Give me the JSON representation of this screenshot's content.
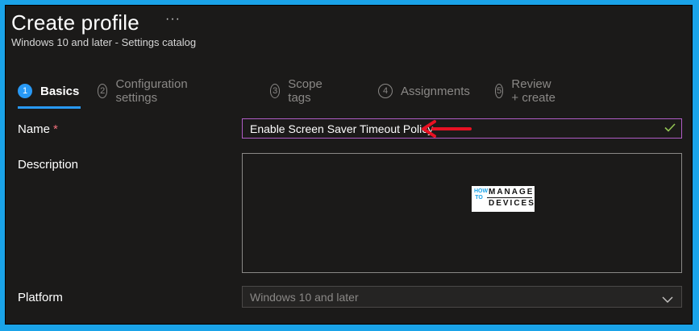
{
  "header": {
    "title": "Create profile",
    "more_label": "···",
    "subtitle": "Windows 10 and later - Settings catalog"
  },
  "steps": [
    {
      "num": "1",
      "label": "Basics",
      "active": true
    },
    {
      "num": "2",
      "label": "Configuration settings",
      "active": false
    },
    {
      "num": "3",
      "label": "Scope tags",
      "active": false
    },
    {
      "num": "4",
      "label": "Assignments",
      "active": false
    },
    {
      "num": "5",
      "label": "Review + create",
      "active": false
    }
  ],
  "form": {
    "name_label": "Name",
    "required_mark": "*",
    "name_value": "Enable Screen Saver Timeout Policy",
    "description_label": "Description",
    "description_value": "",
    "platform_label": "Platform",
    "platform_value": "Windows 10 and later"
  },
  "watermark": {
    "how_to": "HOW TO",
    "line1": "MANAGE",
    "line2": "DEVICES"
  },
  "colors": {
    "accent": "#2899f5",
    "outer_border": "#1aa3e8",
    "input_focus_border": "#b05cc5",
    "arrow": "#e81123",
    "check": "#92c353"
  },
  "icons": {
    "arrow": "red-arrow-icon",
    "check": "checkmark-icon",
    "chevron": "chevron-down-icon"
  }
}
